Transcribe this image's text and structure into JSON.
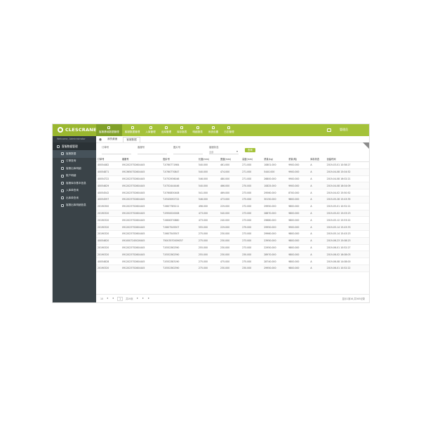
{
  "brand": {
    "name": "CLESCRANE"
  },
  "nav": [
    {
      "label": "客服基础数据管理",
      "icon": "info-icon",
      "active": true
    },
    {
      "label": "客服数据管理",
      "icon": "edit-icon"
    },
    {
      "label": "入库管理",
      "icon": "book-icon"
    },
    {
      "label": "出库管理",
      "icon": "grid-icon"
    },
    {
      "label": "库存报表",
      "icon": "truck-icon"
    },
    {
      "label": "明细报表",
      "icon": "star-icon"
    },
    {
      "label": "系统设置",
      "icon": "user-icon"
    },
    {
      "label": "日志管理",
      "icon": "doc-icon"
    }
  ],
  "top_right": {
    "user_label": "管理员"
  },
  "sidebar": {
    "subtitle": "Welcome, Administrator",
    "header": "客服数据管理",
    "items": [
      {
        "label": "客服数据",
        "active": true
      },
      {
        "label": "订单查询"
      },
      {
        "label": "客服出库明细"
      },
      {
        "label": "账户明细"
      },
      {
        "label": "客服库存基本信息"
      },
      {
        "label": "入库单查询"
      },
      {
        "label": "出库单查询"
      },
      {
        "label": "客服出库明细信息"
      }
    ]
  },
  "tabs": {
    "home": "我的桌面",
    "active": "客服数据"
  },
  "filters": [
    {
      "label": "订单号",
      "value": ""
    },
    {
      "label": "客服号",
      "value": ""
    },
    {
      "label": "图片号",
      "value": ""
    },
    {
      "label": "客服状态",
      "value": "全部",
      "dropdown": true
    }
  ],
  "search_label": "查询",
  "table": {
    "columns": [
      "订单号",
      "客服号",
      "图片号",
      "长度(mm)",
      "宽度(mm)",
      "高度(mm)",
      "重量(kg)",
      "重量(吨)",
      "库存状态",
      "创建时间"
    ],
    "rows": [
      [
        "40054482",
        "0912023752604445",
        "T-0760771984",
        "540.000",
        "461.000",
        "271.000",
        "10801.000",
        "9900.000",
        "A",
        "2019-03-01 10:58:27"
      ],
      [
        "40054871",
        "0913650752604445",
        "T-0760770847",
        "540.000",
        "474.000",
        "271.000",
        "5440.000",
        "9900.000",
        "A",
        "2019-04-08 15:04:52"
      ],
      [
        "40054722",
        "0912023752604445",
        "T-0752936046",
        "546.000",
        "480.000",
        "271.000",
        "26800.000",
        "9900.000",
        "A",
        "2019-04-08 16:02:21"
      ],
      [
        "40054629",
        "0912023752604445",
        "T-0752444446",
        "540.000",
        "466.000",
        "270.000",
        "10825.000",
        "9900.000",
        "A",
        "2019-04-08 16:04:09"
      ],
      [
        "40054542",
        "0912023752604445",
        "T-0760830408",
        "541.000",
        "469.000",
        "273.000",
        "29560.000",
        "8700.000",
        "A",
        "2019-04-02 15:50:52"
      ],
      [
        "40054597",
        "0912023752604445",
        "T-0545092722",
        "546.000",
        "473.000",
        "275.000",
        "30150.000",
        "9800.000",
        "A",
        "2019-05-28 15:43:35"
      ],
      [
        "20190300",
        "0912023752604445",
        "T-0607785211",
        "496.000",
        "229.000",
        "272.000",
        "29950.000",
        "9800.000",
        "A",
        "2019-05-01 10:52:21"
      ],
      [
        "20190320",
        "0912023752604445",
        "T-0950020008",
        "473.000",
        "540.000",
        "273.000",
        "28870.000",
        "9800.000",
        "A",
        "2019-05-02 15:03:23"
      ],
      [
        "20190320",
        "0912023752604445",
        "T-0606370880",
        "473.000",
        "240.000",
        "273.000",
        "29680.000",
        "9800.000",
        "A",
        "2019-05-12 15:53:22"
      ],
      [
        "20190320",
        "0912023752604445",
        "T-0607545507",
        "555.000",
        "229.000",
        "279.000",
        "29950.000",
        "9900.000",
        "A",
        "2019-05-14 15:43:33"
      ],
      [
        "20190320",
        "0912023752604445",
        "T-0607545507",
        "275.000",
        "230.000",
        "273.000",
        "29960.000",
        "9800.000",
        "A",
        "2019-05-14 15:43:23"
      ],
      [
        "40054620",
        "0910007245026445",
        "75003570009037",
        "275.000",
        "230.000",
        "273.000",
        "23950.000",
        "9800.000",
        "A",
        "2019-06-23 15:08:23"
      ],
      [
        "20190320",
        "0912023752604445",
        "T-0552362390",
        "255.000",
        "230.000",
        "273.000",
        "22950.000",
        "9800.000",
        "A",
        "2019-06-01 10:52:27"
      ],
      [
        "20190320",
        "0912023752604445",
        "T-0552362390",
        "255.000",
        "230.000",
        "230.000",
        "28970.000",
        "9800.000",
        "A",
        "2019-06-02 16:08:03"
      ],
      [
        "40054628",
        "0912023752604445",
        "T-0552383190",
        "275.000",
        "475.000",
        "275.000",
        "28740.000",
        "9800.000",
        "A",
        "2019-06-08 14:08:00"
      ],
      [
        "20190320",
        "0912023752604445",
        "T-0552362390",
        "275.000",
        "230.000",
        "230.000",
        "29950.000",
        "9800.000",
        "A",
        "2019-06-01 10:52:22"
      ]
    ]
  },
  "pager": {
    "page_size": "10",
    "current_page": "1",
    "total_pages_text": "共19页",
    "info": "显示1到16,共365记录"
  }
}
